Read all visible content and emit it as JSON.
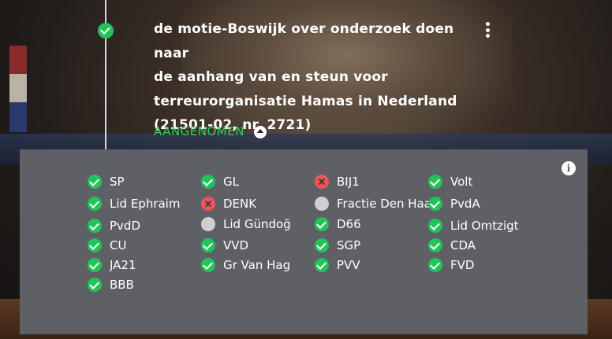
{
  "motion": {
    "title_lines": [
      "de motie-Boswijk over onderzoek doen naar",
      "de aanhang van en steun voor",
      "terreurorganisatie Hamas in Nederland",
      "(21501-02, nr. 2721)"
    ],
    "status": "AANGENOMEN",
    "status_color": "#2fd05e"
  },
  "colors": {
    "for": "#22c45a",
    "against": "#f0545b",
    "absent": "#cfcfcf",
    "panel": "#5e6066"
  },
  "parties": [
    [
      {
        "name": "SP",
        "vote": "for"
      },
      {
        "name": "Lid Ephraim",
        "vote": "for"
      },
      {
        "name": "PvdD",
        "vote": "for"
      },
      {
        "name": "CU",
        "vote": "for"
      },
      {
        "name": "JA21",
        "vote": "for"
      },
      {
        "name": "BBB",
        "vote": "for"
      }
    ],
    [
      {
        "name": "GL",
        "vote": "for"
      },
      {
        "name": "DENK",
        "vote": "against"
      },
      {
        "name": "Lid Gündoğan",
        "vote": "absent"
      },
      {
        "name": "VVD",
        "vote": "for"
      },
      {
        "name": "Gr Van Haga",
        "vote": "for"
      }
    ],
    [
      {
        "name": "BIJ1",
        "vote": "against"
      },
      {
        "name": "Fractie Den Haan",
        "vote": "absent"
      },
      {
        "name": "D66",
        "vote": "for"
      },
      {
        "name": "SGP",
        "vote": "for"
      },
      {
        "name": "PVV",
        "vote": "for"
      }
    ],
    [
      {
        "name": "Volt",
        "vote": "for"
      },
      {
        "name": "PvdA",
        "vote": "for"
      },
      {
        "name": "Lid Omtzigt",
        "vote": "for"
      },
      {
        "name": "CDA",
        "vote": "for"
      },
      {
        "name": "FVD",
        "vote": "for"
      }
    ]
  ]
}
